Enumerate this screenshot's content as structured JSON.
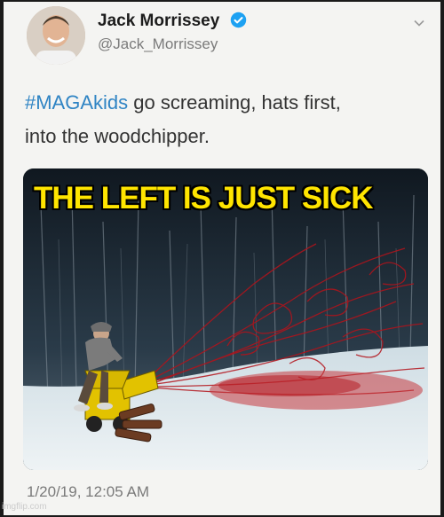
{
  "tweet": {
    "author_name": "Jack Morrissey",
    "author_handle": "@Jack_Morrissey",
    "hashtag": "#MAGAkids",
    "text_line1_rest": " go screaming, hats first,",
    "text_line2": "into the woodchipper.",
    "timestamp": "1/20/19, 12:05 AM"
  },
  "meme": {
    "caption": "THE LEFT IS JUST SICK",
    "watermark": "imgflip.com"
  },
  "icons": {
    "verified": "verified-badge-icon",
    "menu": "chevron-down-icon"
  },
  "colors": {
    "hashtag": "#2f84c4",
    "verified": "#1da1f2",
    "caption": "#ffe500",
    "blood": "#b3131b"
  }
}
